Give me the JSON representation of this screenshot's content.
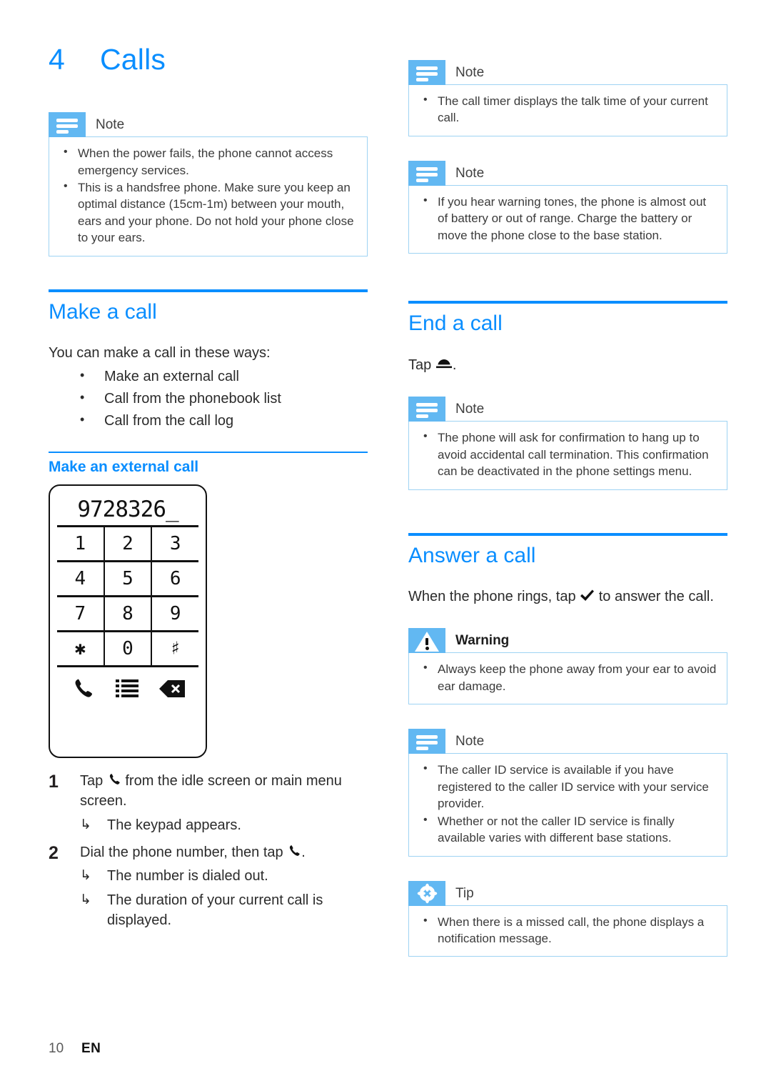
{
  "chapter": {
    "number": "4",
    "title": "Calls"
  },
  "colors": {
    "accent_blue": "#0a8eff",
    "callout_icon_blue": "#62b8f2",
    "callout_border_blue": "#9ed3f3",
    "body_text": "#2b2b2b"
  },
  "left_column": {
    "note_top": {
      "label": "Note",
      "icon": "note-icon",
      "items": [
        "When the power fails, the phone cannot access emergency services.",
        "This is a handsfree phone. Make sure you keep an optimal distance (15cm-1m) between your mouth, ears and your phone. Do not hold your phone close to your ears."
      ]
    },
    "make_a_call": {
      "heading": "Make a call",
      "intro": "You can make a call in these ways:",
      "ways": [
        "Make an external call",
        "Call from the phonebook list",
        "Call from the call log"
      ]
    },
    "make_external_call": {
      "heading": "Make an external call",
      "keypad": {
        "display": "9728326_",
        "keys": [
          "1",
          "2",
          "3",
          "4",
          "5",
          "6",
          "7",
          "8",
          "9",
          "✱",
          "0",
          "♯"
        ],
        "softkeys": [
          "call-icon",
          "list-icon",
          "backspace-icon"
        ]
      },
      "steps": [
        {
          "number": "1",
          "text_before": "Tap",
          "icon": "call-handset-icon",
          "text_after": "from the idle screen or main menu screen.",
          "results": [
            "The keypad appears."
          ]
        },
        {
          "number": "2",
          "text_before": "Dial the phone number, then tap",
          "icon": "call-handset-icon",
          "text_after": ".",
          "results": [
            "The number is dialed out.",
            "The duration of your current call is displayed."
          ]
        }
      ]
    }
  },
  "right_column": {
    "note_call_timer": {
      "label": "Note",
      "icon": "note-icon",
      "items": [
        "The call timer displays the talk time of your current call."
      ]
    },
    "note_warning_tones": {
      "label": "Note",
      "icon": "note-icon",
      "items": [
        "If you hear warning tones, the phone is almost out of battery or out of range. Charge the battery or move the phone close to the base station."
      ]
    },
    "end_a_call": {
      "heading": "End a call",
      "instruction_before": "Tap",
      "instruction_icon": "hang-up-icon",
      "instruction_after": ".",
      "note": {
        "label": "Note",
        "icon": "note-icon",
        "items": [
          "The phone will ask for confirmation to hang up to avoid accidental call termination. This confirmation can be deactivated in the phone settings menu."
        ]
      }
    },
    "answer_a_call": {
      "heading": "Answer a call",
      "instruction_before": "When the phone rings, tap",
      "instruction_icon": "check-icon",
      "instruction_after": "to answer the call.",
      "warning": {
        "label": "Warning",
        "icon": "warning-icon",
        "items": [
          "Always keep the phone away from your ear to avoid ear damage."
        ]
      },
      "note": {
        "label": "Note",
        "icon": "note-icon",
        "items": [
          "The caller ID service is available if you have registered to the caller ID service with your service provider.",
          "Whether or not the caller ID service is finally available varies with different base stations."
        ]
      },
      "tip": {
        "label": "Tip",
        "icon": "tip-icon",
        "items": [
          "When there is a missed call, the phone displays a notification message."
        ]
      }
    }
  },
  "footer": {
    "page_number": "10",
    "language": "EN"
  }
}
